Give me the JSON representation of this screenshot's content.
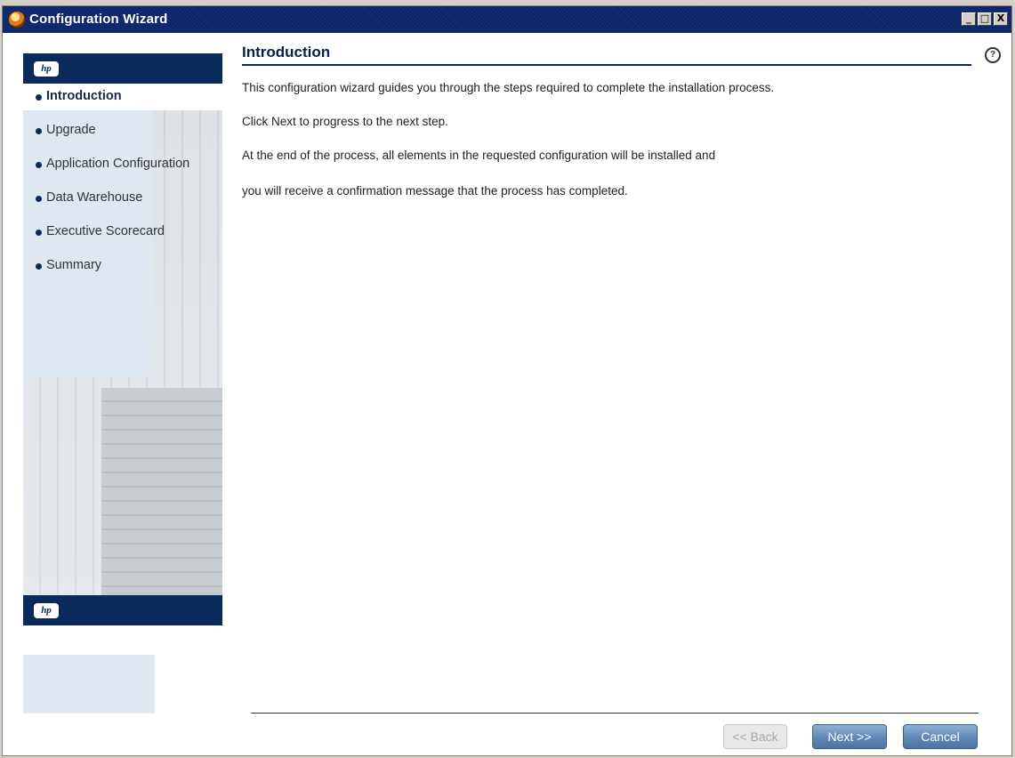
{
  "window": {
    "title": "Configuration Wizard"
  },
  "window_controls": {
    "minimize": "_",
    "maximize": "□",
    "close": "X"
  },
  "sidebar": {
    "logo_text": "hp",
    "steps": [
      {
        "label": "Introduction",
        "active": true
      },
      {
        "label": "Upgrade",
        "active": false
      },
      {
        "label": "Application Configuration",
        "active": false
      },
      {
        "label": "Data Warehouse",
        "active": false
      },
      {
        "label": "Executive Scorecard",
        "active": false
      },
      {
        "label": "Summary",
        "active": false
      }
    ]
  },
  "main": {
    "title": "Introduction",
    "help_icon": "?",
    "paragraphs": [
      "This configuration wizard guides you through the steps required to complete the installation process.",
      "Click Next to progress to the next step.",
      "At the end of the process, all elements in the requested configuration will be installed and",
      "you will receive a confirmation message that the process has completed."
    ]
  },
  "buttons": {
    "back": "<< Back",
    "next": "Next >>",
    "cancel": "Cancel"
  },
  "colors": {
    "titlebar": "#0b246a",
    "accent": "#0a2a5c",
    "button": "#5f88b6"
  }
}
